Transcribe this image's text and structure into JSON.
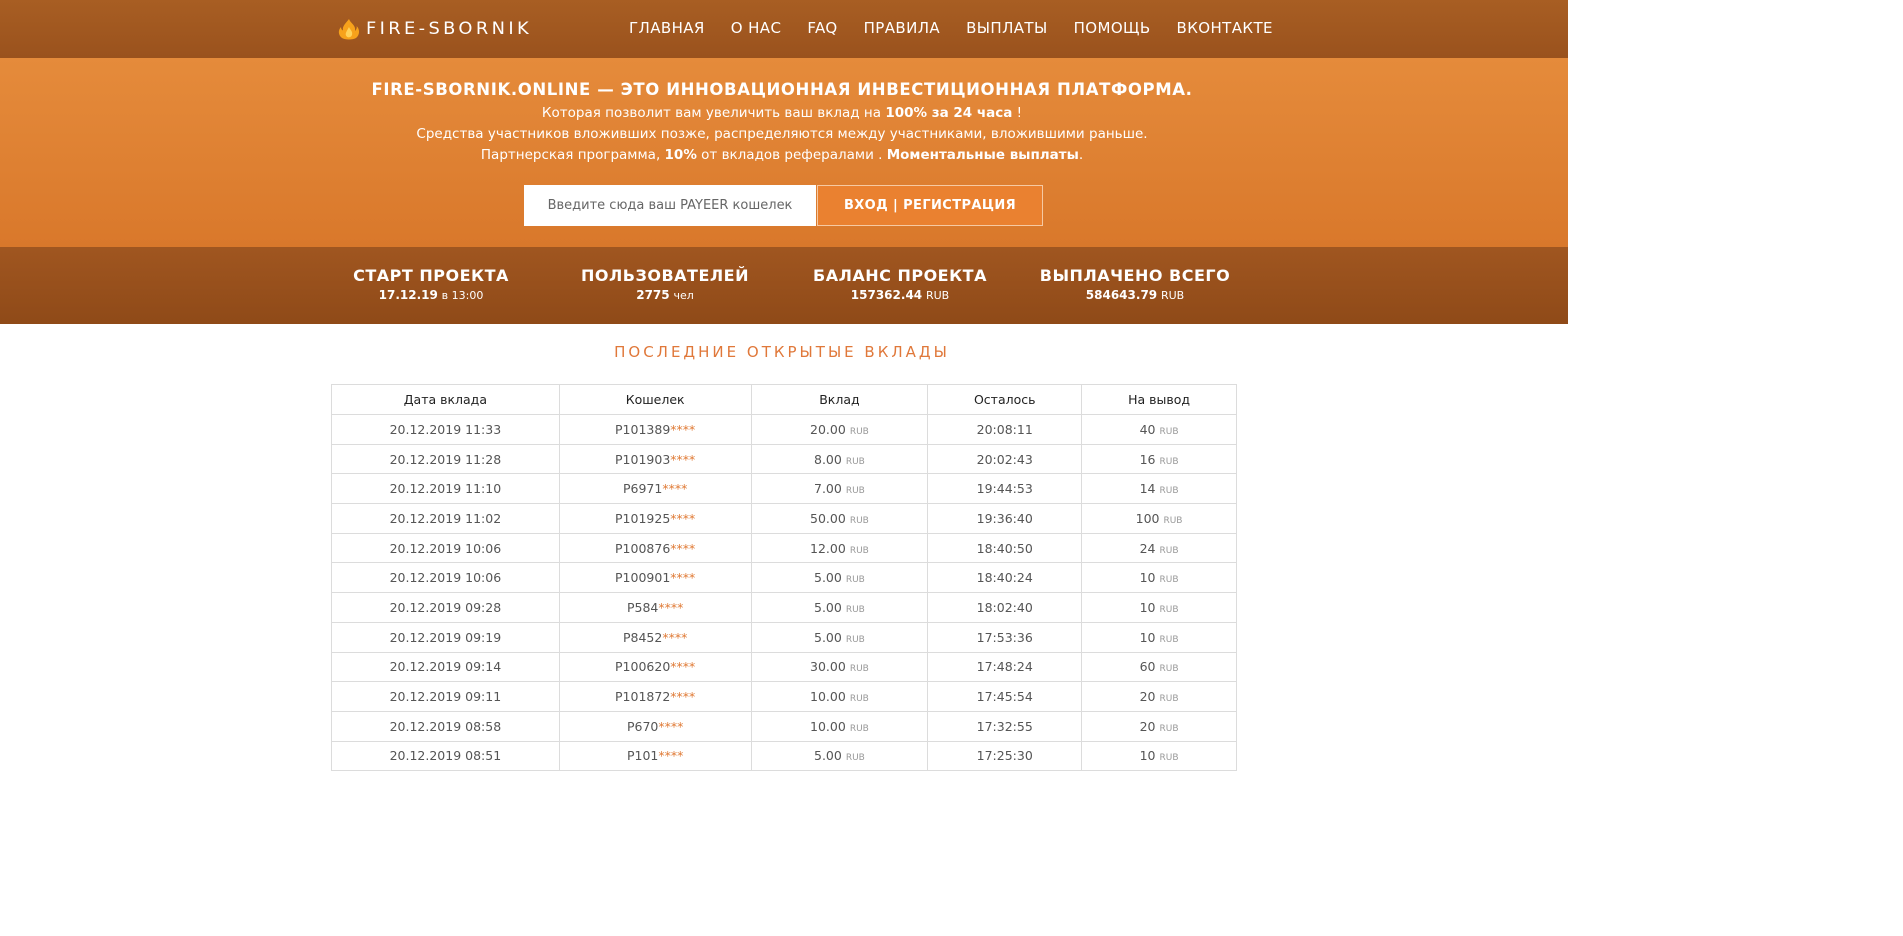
{
  "header": {
    "logo_text": "FIRE-SBORNIK",
    "logo_icon": "flame-icon",
    "nav": [
      {
        "label": "ГЛАВНАЯ"
      },
      {
        "label": "О НАС"
      },
      {
        "label": "FAQ"
      },
      {
        "label": "ПРАВИЛА"
      },
      {
        "label": "ВЫПЛАТЫ"
      },
      {
        "label": "ПОМОЩЬ"
      },
      {
        "label": "ВКОНТАКТЕ"
      }
    ]
  },
  "hero": {
    "title": "FIRE-SBORNIK.ONLINE — ЭТО ИННОВАЦИОННАЯ ИНВЕСТИЦИОННАЯ ПЛАТФОРМА.",
    "line1_pre": "Которая позволит вам увеличить ваш вклад на ",
    "line1_bold": "100% за 24 часа",
    "line1_post": " !",
    "line2": "Средства участников вложивших позже, распределяются между участниками, вложившими раньше.",
    "line3_pre": "Партнерская программа, ",
    "line3_bold1": "10%",
    "line3_mid": " от вкладов рефералами . ",
    "line3_bold2": "Моментальные выплаты",
    "line3_post": ".",
    "input_placeholder": "Введите сюда ваш PAYEER кошелек",
    "button_label": "ВХОД | РЕГИСТРАЦИЯ"
  },
  "stats": [
    {
      "label": "СТАРТ ПРОЕКТА",
      "value": "17.12.19",
      "unit": "в 13:00"
    },
    {
      "label": "ПОЛЬЗОВАТЕЛЕЙ",
      "value": "2775",
      "unit": "чел"
    },
    {
      "label": "БАЛАНС ПРОЕКТА",
      "value": "157362.44",
      "unit": "RUB"
    },
    {
      "label": "ВЫПЛАЧЕНО ВСЕГО",
      "value": "584643.79",
      "unit": "RUB"
    }
  ],
  "deposits": {
    "title": "ПОСЛЕДНИЕ ОТКРЫТЫЕ ВКЛАДЫ",
    "columns": [
      "Дата вклада",
      "Кошелек",
      "Вклад",
      "Осталось",
      "На вывод"
    ],
    "currency": "RUB",
    "mask": "****",
    "rows": [
      {
        "date": "20.12.2019 11:33",
        "wallet": "P101389",
        "amount": "20.00",
        "left": "20:08:11",
        "payout": "40"
      },
      {
        "date": "20.12.2019 11:28",
        "wallet": "P101903",
        "amount": "8.00",
        "left": "20:02:43",
        "payout": "16"
      },
      {
        "date": "20.12.2019 11:10",
        "wallet": "P6971",
        "amount": "7.00",
        "left": "19:44:53",
        "payout": "14"
      },
      {
        "date": "20.12.2019 11:02",
        "wallet": "P101925",
        "amount": "50.00",
        "left": "19:36:40",
        "payout": "100"
      },
      {
        "date": "20.12.2019 10:06",
        "wallet": "P100876",
        "amount": "12.00",
        "left": "18:40:50",
        "payout": "24"
      },
      {
        "date": "20.12.2019 10:06",
        "wallet": "P100901",
        "amount": "5.00",
        "left": "18:40:24",
        "payout": "10"
      },
      {
        "date": "20.12.2019 09:28",
        "wallet": "P584",
        "amount": "5.00",
        "left": "18:02:40",
        "payout": "10"
      },
      {
        "date": "20.12.2019 09:19",
        "wallet": "P8452",
        "amount": "5.00",
        "left": "17:53:36",
        "payout": "10"
      },
      {
        "date": "20.12.2019 09:14",
        "wallet": "P100620",
        "amount": "30.00",
        "left": "17:48:24",
        "payout": "60"
      },
      {
        "date": "20.12.2019 09:11",
        "wallet": "P101872",
        "amount": "10.00",
        "left": "17:45:54",
        "payout": "20"
      },
      {
        "date": "20.12.2019 08:58",
        "wallet": "P670",
        "amount": "10.00",
        "left": "17:32:55",
        "payout": "20"
      },
      {
        "date": "20.12.2019 08:51",
        "wallet": "P101",
        "amount": "5.00",
        "left": "17:25:30",
        "payout": "10"
      }
    ]
  }
}
